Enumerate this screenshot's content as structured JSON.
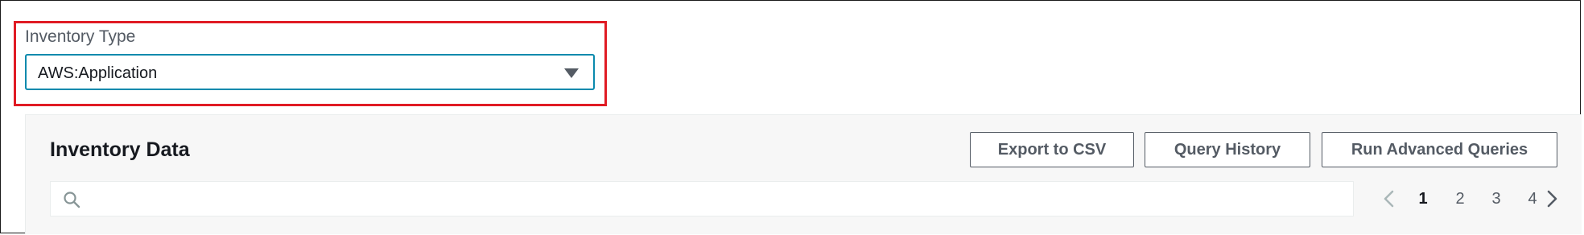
{
  "inventory_type": {
    "label": "Inventory Type",
    "selected": "AWS:Application"
  },
  "panel": {
    "title": "Inventory Data",
    "buttons": {
      "export": "Export to CSV",
      "history": "Query History",
      "advanced": "Run Advanced Queries"
    },
    "search": {
      "placeholder": "",
      "value": ""
    },
    "pagination": {
      "pages": [
        "1",
        "2",
        "3",
        "4"
      ],
      "current": "1"
    }
  },
  "icons": {
    "dropdown": "caret-down-icon",
    "search": "search-icon",
    "prev": "chevron-left-icon",
    "next": "chevron-right-icon"
  },
  "colors": {
    "highlight": "#e01b24",
    "focus_border": "#0a8aad",
    "panel_bg": "#f7f7f7",
    "button_text": "#545b64"
  }
}
